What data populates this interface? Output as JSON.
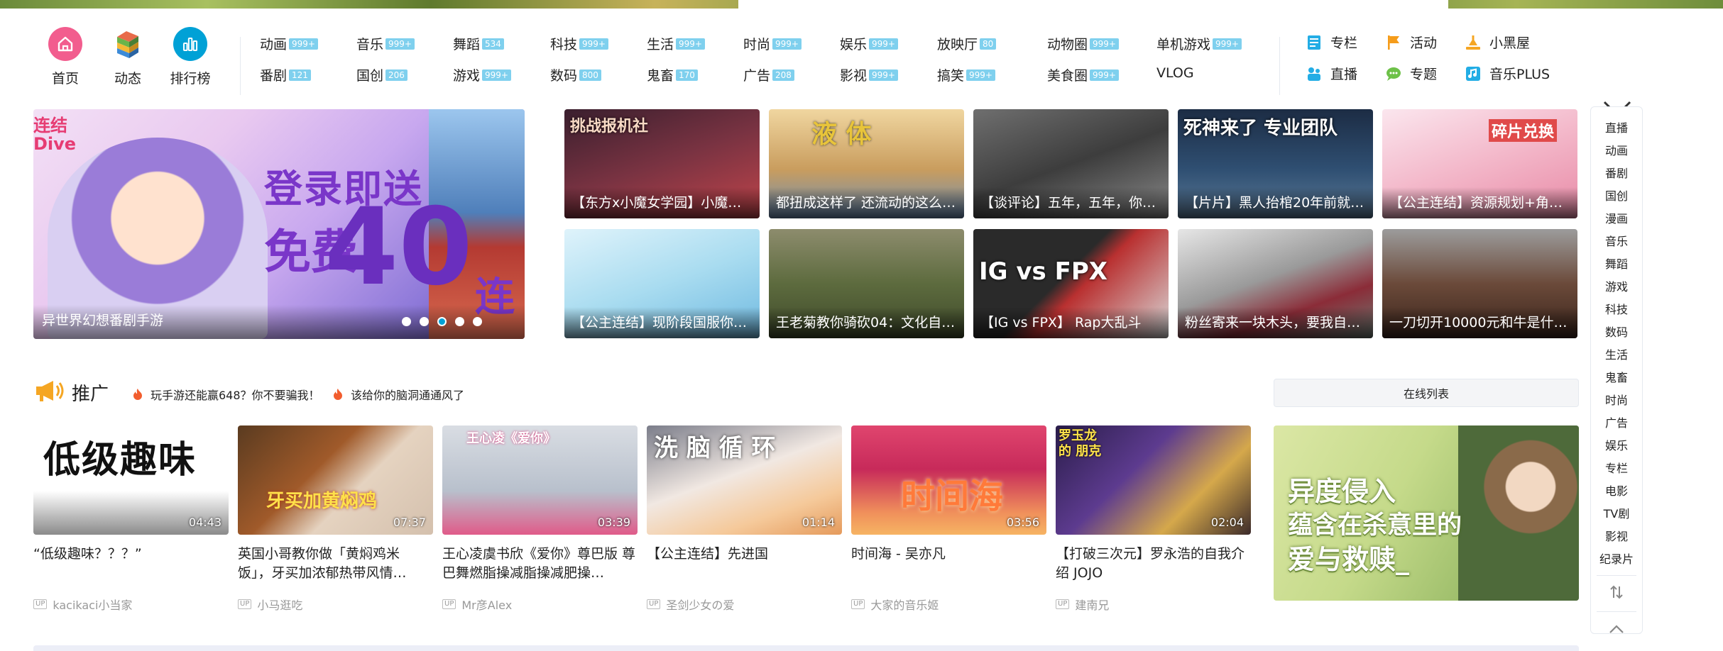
{
  "quick_nav": [
    {
      "label": "首页",
      "icon": "home-icon"
    },
    {
      "label": "动态",
      "icon": "dynamic-icon"
    },
    {
      "label": "排行榜",
      "icon": "ranking-icon"
    }
  ],
  "categories_row1": [
    {
      "label": "动画",
      "badge": "999+"
    },
    {
      "label": "音乐",
      "badge": "999+"
    },
    {
      "label": "舞蹈",
      "badge": "534"
    },
    {
      "label": "科技",
      "badge": "999+"
    },
    {
      "label": "生活",
      "badge": "999+"
    },
    {
      "label": "时尚",
      "badge": "999+"
    },
    {
      "label": "娱乐",
      "badge": "999+"
    },
    {
      "label": "放映厅",
      "badge": "80"
    },
    {
      "label": "动物圈",
      "badge": "999+"
    },
    {
      "label": "单机游戏",
      "badge": "999+"
    }
  ],
  "categories_row2": [
    {
      "label": "番剧",
      "badge": "121"
    },
    {
      "label": "国创",
      "badge": "206"
    },
    {
      "label": "游戏",
      "badge": "999+"
    },
    {
      "label": "数码",
      "badge": "800"
    },
    {
      "label": "鬼畜",
      "badge": "170"
    },
    {
      "label": "广告",
      "badge": "208"
    },
    {
      "label": "影视",
      "badge": "999+"
    },
    {
      "label": "搞笑",
      "badge": "999+"
    },
    {
      "label": "美食圈",
      "badge": "999+"
    },
    {
      "label": "VLOG",
      "badge": ""
    }
  ],
  "extra_links": [
    {
      "label": "专栏",
      "icon": "column-icon",
      "color": "#23ade5"
    },
    {
      "label": "活动",
      "icon": "flag-icon",
      "color": "#f59c1a"
    },
    {
      "label": "小黑屋",
      "icon": "blackroom-icon",
      "color": "#f5a623"
    },
    {
      "label": "直播",
      "icon": "live-icon",
      "color": "#23ade5"
    },
    {
      "label": "专题",
      "icon": "topic-icon",
      "color": "#6dc148"
    },
    {
      "label": "音乐PLUS",
      "icon": "music-plus-icon",
      "color": "#23ade5"
    }
  ],
  "carousel": {
    "logo_line1": "连结",
    "logo_line2": "Dive",
    "promo_line1": "登录即送",
    "promo_line2": "免费",
    "promo_number": "40",
    "promo_char": "连",
    "caption": "异世界幻想番剧手游",
    "dots": 5,
    "active_dot": 2
  },
  "featured": [
    {
      "title": "【东方x小魔女学园】小魔…",
      "overlay": "挑战报机社"
    },
    {
      "title": "都扭成这样了 还流动的这么…",
      "overlay": "液    体"
    },
    {
      "title": "【谈评论】五年，五年，你…",
      "overlay": ""
    },
    {
      "title": "【片片】黑人抬棺20年前就…",
      "overlay": "死神来了 专业团队"
    },
    {
      "title": "【公主连结】资源规划+角…",
      "overlay": "碎片兑换"
    },
    {
      "title": "【公主连结】现阶段国服你…",
      "overlay": ""
    },
    {
      "title": "王老菊教你骑砍04：文化自…",
      "overlay": ""
    },
    {
      "title": "【IG vs FPX】 Rap大乱斗",
      "overlay": "IG  vs  FPX"
    },
    {
      "title": "粉丝寄来一块木头，要我自…",
      "overlay": ""
    },
    {
      "title": "一刀切开10000元和牛是什…",
      "overlay": ""
    }
  ],
  "promo": {
    "title": "推广",
    "links": [
      "玩手游还能赢648？你不要骗我！",
      "该给你的脑洞通通风了"
    ]
  },
  "videos": [
    {
      "title": "“低级趣味？？？”",
      "duration": "04:43",
      "up": "kacikaci小当家",
      "overlay": "低级趣味"
    },
    {
      "title": "英国小哥教你做「黄焖鸡米饭」，牙买加浓郁热带风情…",
      "duration": "07:37",
      "up": "小马逛吃",
      "overlay": "牙买加黄焖鸡"
    },
    {
      "title": "王心凌虞书欣《爱你》尊巴版 尊巴舞燃脂操减脂操减肥操…",
      "duration": "03:39",
      "up": "Mr彦Alex",
      "overlay": "王心凌《爱你》"
    },
    {
      "title": "【公主连结】先进国",
      "duration": "01:14",
      "up": "圣剑少女の爱",
      "overlay": "洗 脑 循 环"
    },
    {
      "title": "时间海 - 吴亦凡",
      "duration": "03:56",
      "up": "大家的音乐姬",
      "overlay": "时间海"
    },
    {
      "title": "【打破三次元】罗永浩的自我介绍 JOJO",
      "duration": "02:04",
      "up": "建南兄",
      "overlay": "罗玉龙的 朋克"
    }
  ],
  "up_badge": "UP",
  "online_list": "在线列表",
  "ad": {
    "line1": "异度侵入",
    "line2": "蕴含在杀意里的",
    "line3": "爱与救赎_"
  },
  "side_nav": [
    "直播",
    "动画",
    "番剧",
    "国创",
    "漫画",
    "音乐",
    "舞蹈",
    "游戏",
    "科技",
    "数码",
    "生活",
    "鬼畜",
    "时尚",
    "广告",
    "娱乐",
    "专栏",
    "电影",
    "TV剧",
    "影视",
    "纪录片"
  ]
}
